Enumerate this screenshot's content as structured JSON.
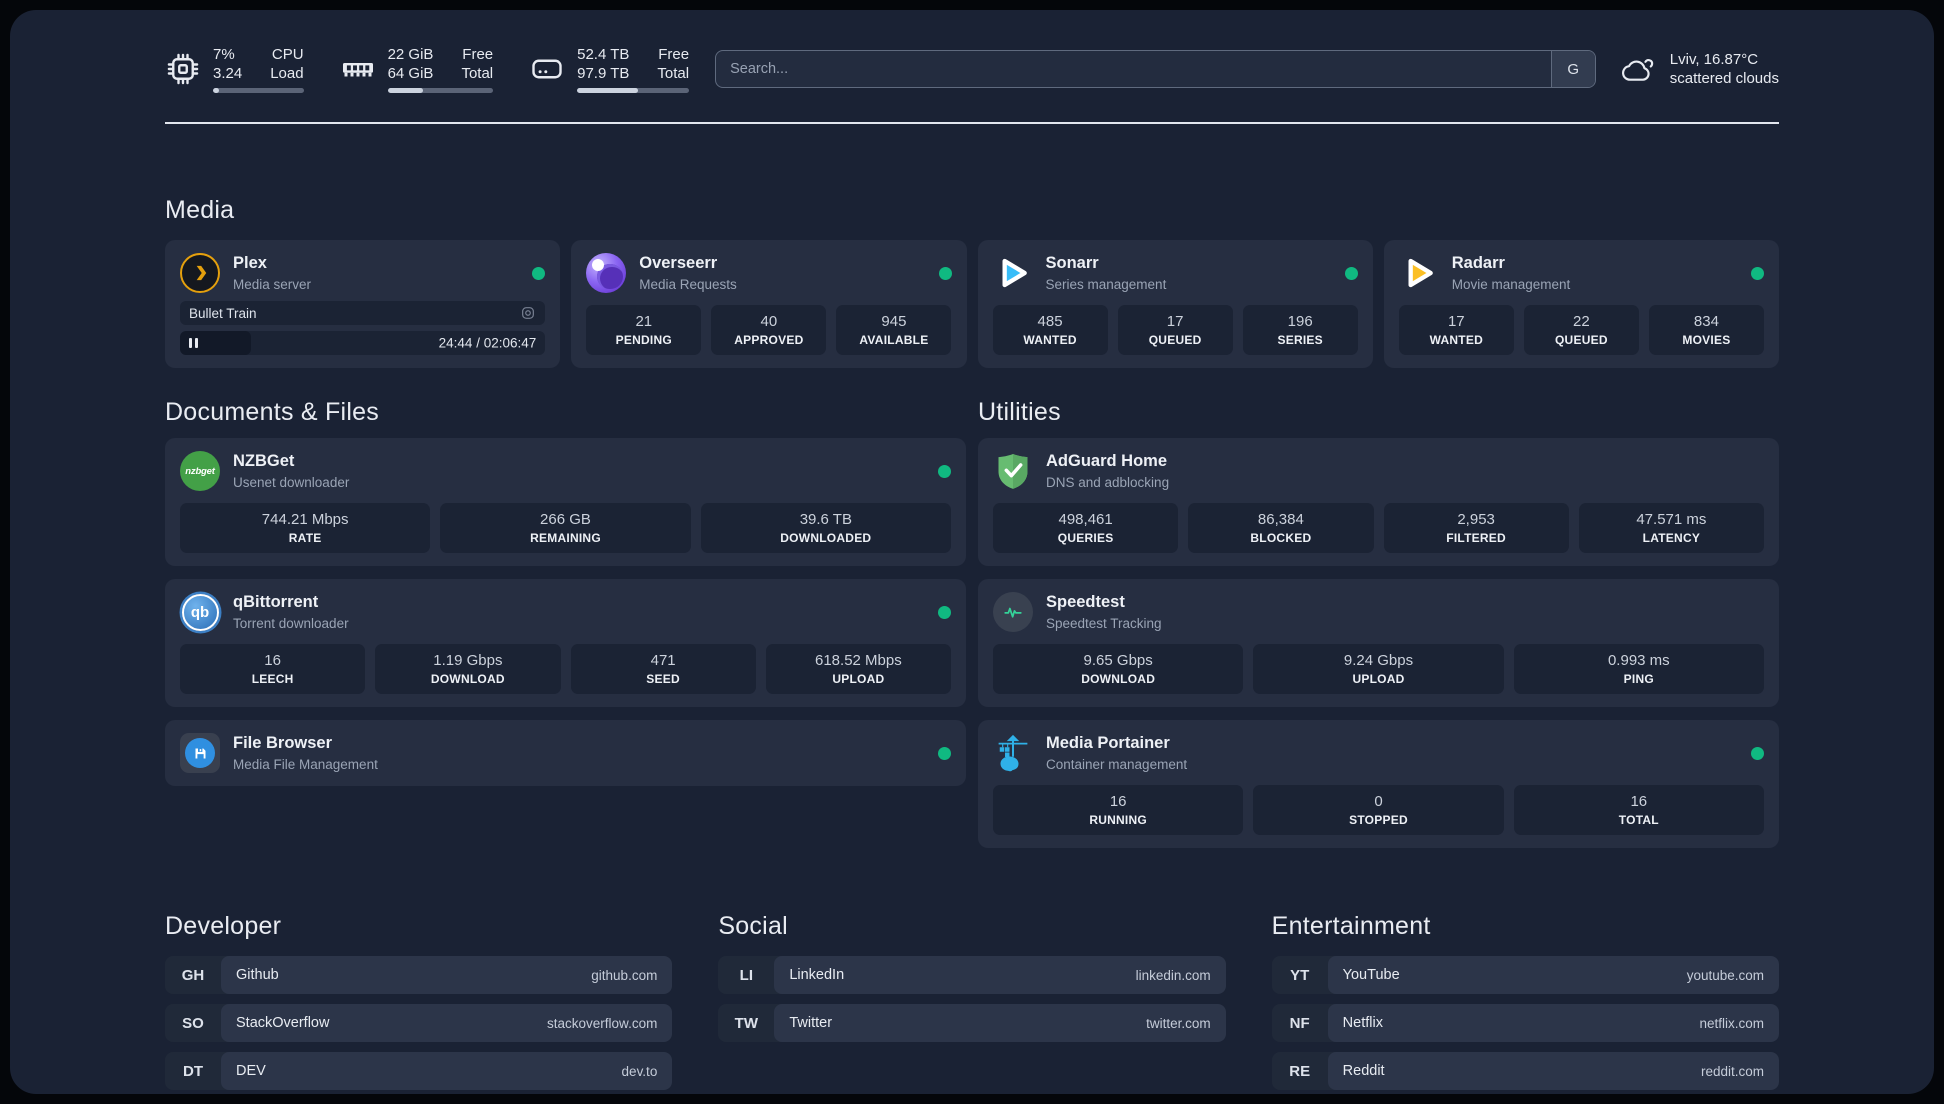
{
  "topbar": {
    "widgets": [
      {
        "icon": "cpu-icon",
        "value_top": "7%",
        "value_bottom": "3.24",
        "label_top": "CPU",
        "label_bottom": "Load",
        "progress_pct": 7
      },
      {
        "icon": "memory-icon",
        "value_top": "22 GiB",
        "value_bottom": "64 GiB",
        "label_top": "Free",
        "label_bottom": "Total",
        "progress_pct": 34
      },
      {
        "icon": "disk-icon",
        "value_top": "52.4 TB",
        "value_bottom": "97.9 TB",
        "label_top": "Free",
        "label_bottom": "Total",
        "progress_pct": 54
      }
    ],
    "search": {
      "placeholder": "Search...",
      "provider_badge": "G"
    },
    "weather": {
      "icon": "scattered-clouds-icon",
      "location": "Lviv, 16.87°C",
      "condition": "scattered clouds"
    }
  },
  "sections": {
    "media": {
      "title": "Media",
      "cards": [
        {
          "icon": "plex-icon",
          "title": "Plex",
          "subtitle": "Media server",
          "status": "online",
          "now_playing": {
            "title": "Bullet Train",
            "state": "paused",
            "control_icon": "pause-icon",
            "session_icon": "video-session-icon",
            "time_display": "24:44 / 02:06:47",
            "progress_pct": 19.5
          }
        },
        {
          "icon": "overseerr-icon",
          "title": "Overseerr",
          "subtitle": "Media Requests",
          "status": "online",
          "stats": [
            {
              "value": "21",
              "label": "PENDING"
            },
            {
              "value": "40",
              "label": "APPROVED"
            },
            {
              "value": "945",
              "label": "AVAILABLE"
            }
          ]
        },
        {
          "icon": "sonarr-icon",
          "title": "Sonarr",
          "subtitle": "Series management",
          "status": "online",
          "stats": [
            {
              "value": "485",
              "label": "WANTED"
            },
            {
              "value": "17",
              "label": "QUEUED"
            },
            {
              "value": "196",
              "label": "SERIES"
            }
          ]
        },
        {
          "icon": "radarr-icon",
          "title": "Radarr",
          "subtitle": "Movie management",
          "status": "online",
          "stats": [
            {
              "value": "17",
              "label": "WANTED"
            },
            {
              "value": "22",
              "label": "QUEUED"
            },
            {
              "value": "834",
              "label": "MOVIES"
            }
          ]
        }
      ]
    },
    "documents": {
      "title": "Documents & Files",
      "cards": [
        {
          "icon": "nzbget-icon",
          "title": "NZBGet",
          "subtitle": "Usenet downloader",
          "status": "online",
          "stats": [
            {
              "value": "744.21 Mbps",
              "label": "RATE"
            },
            {
              "value": "266 GB",
              "label": "REMAINING"
            },
            {
              "value": "39.6 TB",
              "label": "DOWNLOADED"
            }
          ]
        },
        {
          "icon": "qbittorrent-icon",
          "title": "qBittorrent",
          "subtitle": "Torrent downloader",
          "status": "online",
          "stats": [
            {
              "value": "16",
              "label": "LEECH"
            },
            {
              "value": "1.19 Gbps",
              "label": "DOWNLOAD"
            },
            {
              "value": "471",
              "label": "SEED"
            },
            {
              "value": "618.52 Mbps",
              "label": "UPLOAD"
            }
          ]
        },
        {
          "icon": "filebrowser-icon",
          "title": "File Browser",
          "subtitle": "Media File Management",
          "status": "online",
          "stats": []
        }
      ]
    },
    "utilities": {
      "title": "Utilities",
      "cards": [
        {
          "icon": "adguard-icon",
          "title": "AdGuard Home",
          "subtitle": "DNS and adblocking",
          "stats": [
            {
              "value": "498,461",
              "label": "QUERIES"
            },
            {
              "value": "86,384",
              "label": "BLOCKED"
            },
            {
              "value": "2,953",
              "label": "FILTERED"
            },
            {
              "value": "47.571 ms",
              "label": "LATENCY"
            }
          ]
        },
        {
          "icon": "speedtest-icon",
          "title": "Speedtest",
          "subtitle": "Speedtest Tracking",
          "stats": [
            {
              "value": "9.65 Gbps",
              "label": "DOWNLOAD"
            },
            {
              "value": "9.24 Gbps",
              "label": "UPLOAD"
            },
            {
              "value": "0.993 ms",
              "label": "PING"
            }
          ]
        },
        {
          "icon": "portainer-icon",
          "title": "Media Portainer",
          "subtitle": "Container management",
          "status": "online",
          "stats": [
            {
              "value": "16",
              "label": "RUNNING"
            },
            {
              "value": "0",
              "label": "STOPPED"
            },
            {
              "value": "16",
              "label": "TOTAL"
            }
          ]
        }
      ]
    }
  },
  "bookmarks": [
    {
      "title": "Developer",
      "links": [
        {
          "abbr": "GH",
          "name": "Github",
          "domain": "github.com"
        },
        {
          "abbr": "SO",
          "name": "StackOverflow",
          "domain": "stackoverflow.com"
        },
        {
          "abbr": "DT",
          "name": "DEV",
          "domain": "dev.to"
        }
      ]
    },
    {
      "title": "Social",
      "links": [
        {
          "abbr": "LI",
          "name": "LinkedIn",
          "domain": "linkedin.com"
        },
        {
          "abbr": "TW",
          "name": "Twitter",
          "domain": "twitter.com"
        }
      ]
    },
    {
      "title": "Entertainment",
      "links": [
        {
          "abbr": "YT",
          "name": "YouTube",
          "domain": "youtube.com"
        },
        {
          "abbr": "NF",
          "name": "Netflix",
          "domain": "netflix.com"
        },
        {
          "abbr": "RE",
          "name": "Reddit",
          "domain": "reddit.com"
        }
      ]
    }
  ],
  "colors": {
    "page_background": "#1a2234",
    "card_background": "#262e41",
    "stat_background": "#1b2334",
    "status_online": "#10b981",
    "divider": "#e2e6ee",
    "plex_accent": "#e5a00d",
    "overseerr_purple": "#8b66f2",
    "sonarr_blue": "#38bdf8",
    "radarr_yellow": "#fbbf24",
    "nzbget_green": "#43a047",
    "qbittorrent_blue": "#3c7fc4",
    "filebrowser_blue": "#2f8fe0",
    "adguard_green": "#5fb963",
    "speedtest_pulse": "#34d399",
    "portainer_blue": "#2fb1e8"
  }
}
